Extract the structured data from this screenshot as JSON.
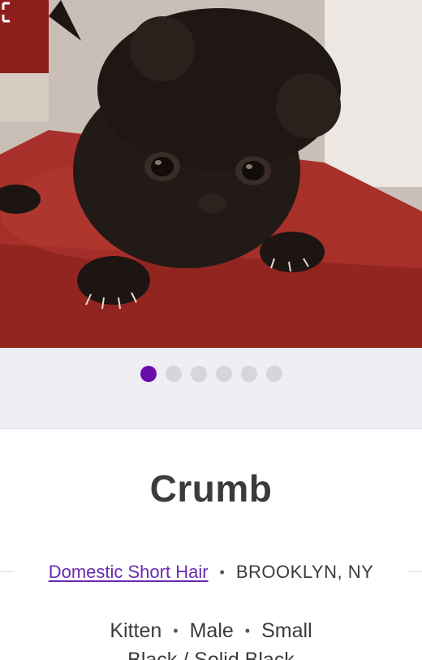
{
  "pet": {
    "name": "Crumb",
    "breed": "Domestic Short Hair",
    "location": "BROOKLYN, NY",
    "separator": "•",
    "age": "Kitten",
    "sex": "Male",
    "size": "Small",
    "color_partial": "Black / Solid Black"
  },
  "carousel": {
    "total": 6,
    "active_index": 0
  },
  "photo": {
    "subject": "black kitten on red table",
    "icon": "expand-icon"
  },
  "colors": {
    "accent": "#6a0dad",
    "link": "#6a2bb0",
    "dot_inactive": "#d6d5da",
    "band_background": "#efeef2"
  }
}
